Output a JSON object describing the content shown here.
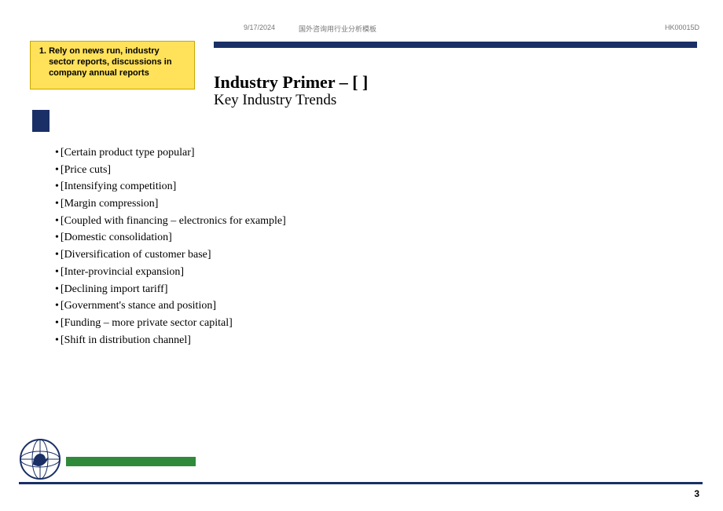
{
  "header": {
    "date": "9/17/2024",
    "center_text": "国外咨询用行业分析模板",
    "doc_id": "HK00015D"
  },
  "callout": {
    "number": "1.",
    "text": "Rely on news run, industry sector reports, discussions in company annual reports"
  },
  "title": "Industry Primer – [    ]",
  "subtitle": "Key Industry Trends",
  "bullets": [
    "[Certain product type popular]",
    "[Price cuts]",
    "[Intensifying competition]",
    "[Margin compression]",
    "[Coupled with financing – electronics for example]",
    "[Domestic consolidation]",
    "[Diversification of customer base]",
    "[Inter-provincial expansion]",
    "[Declining import tariff]",
    "[Government's stance and position]",
    "[Funding – more private sector capital]",
    "[Shift in distribution channel]"
  ],
  "page_number": "3"
}
